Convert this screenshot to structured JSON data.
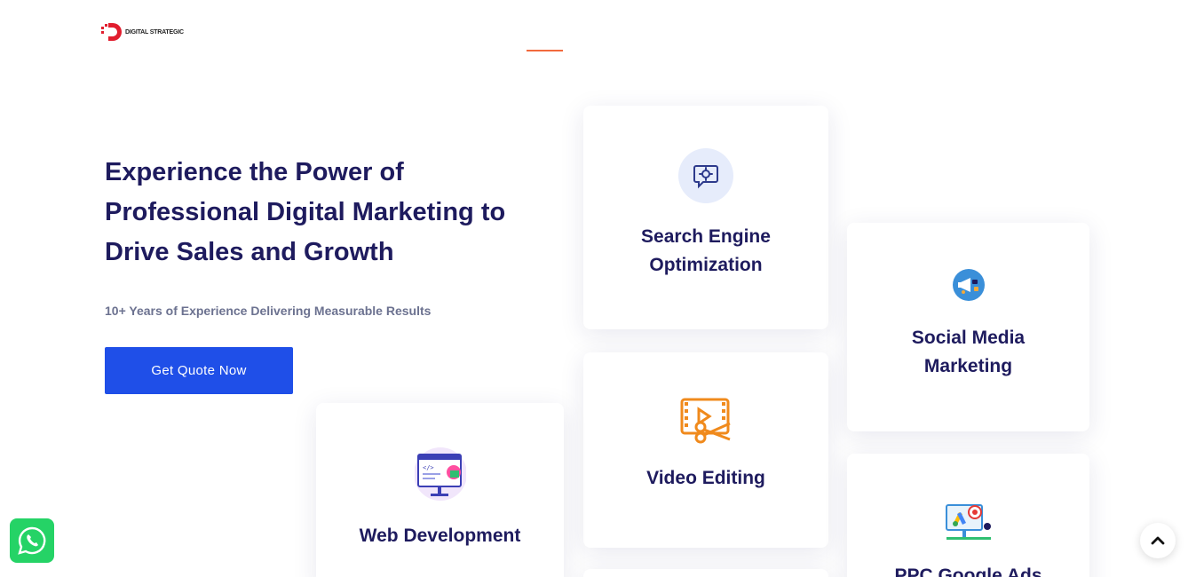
{
  "header": {
    "logo_text": "DIGITAL STRATEGIC",
    "accent_color": "#f26a3d",
    "brand_red": "#e11d2e"
  },
  "hero": {
    "title": "Experience the Power of Professional Digital Marketing to Drive Sales and Growth",
    "subtitle": "10+ Years of Experience Delivering Measurable Results",
    "cta_label": "Get Quote Now",
    "cta_color": "#1f4fe8"
  },
  "services": {
    "seo": {
      "title": "Search Engine Optimization",
      "icon": "seo-gear-chat-icon"
    },
    "smm": {
      "title": "Social Media Marketing",
      "icon": "megaphone-icon"
    },
    "video": {
      "title": "Video Editing",
      "icon": "video-scissors-icon"
    },
    "web": {
      "title": "Web Development",
      "icon": "monitor-code-icon"
    },
    "ppc": {
      "title": "PPC Google Ads",
      "icon": "google-ads-target-icon"
    }
  },
  "floating": {
    "whatsapp_icon": "whatsapp-icon",
    "scroll_top_icon": "chevron-up-icon"
  }
}
